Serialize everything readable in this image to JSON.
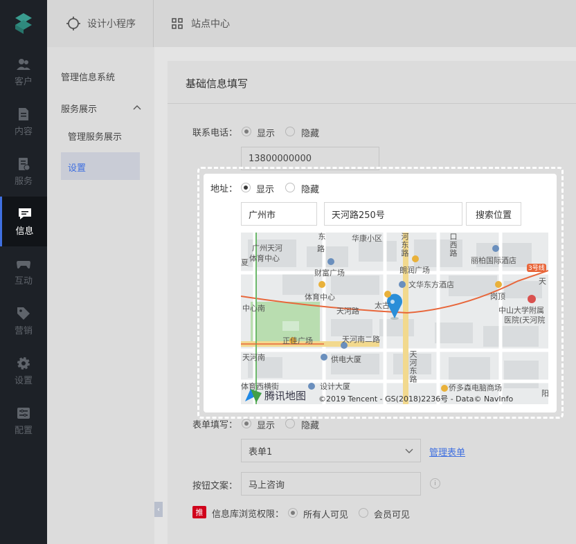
{
  "nav": {
    "items": [
      {
        "label": "客户",
        "icon": "customers-icon"
      },
      {
        "label": "内容",
        "icon": "content-icon"
      },
      {
        "label": "服务",
        "icon": "service-icon"
      },
      {
        "label": "信息",
        "icon": "message-icon"
      },
      {
        "label": "互动",
        "icon": "gamepad-icon"
      },
      {
        "label": "营销",
        "icon": "tag-icon"
      },
      {
        "label": "设置",
        "icon": "gear-icon"
      },
      {
        "label": "配置",
        "icon": "config-icon"
      }
    ],
    "active_index": 3,
    "accent": "#3f6fe0"
  },
  "topbar": {
    "tab1": "设计小程序",
    "tab2": "站点中心"
  },
  "subnav": {
    "system": "管理信息系统",
    "group": "服务展示",
    "item1": "管理服务展示",
    "item2": "设置"
  },
  "panel": {
    "title": "基础信息填写",
    "phone": {
      "label": "联系电话：",
      "show": "显示",
      "hide": "隐藏",
      "value": "13800000000"
    },
    "form": {
      "label": "表单填写：",
      "show": "显示",
      "hide": "隐藏",
      "selected": "表单1",
      "manage_link": "管理表单"
    },
    "button_text": {
      "label": "按钮文案：",
      "value": "马上咨询"
    },
    "permission": {
      "badge": "推",
      "label": "信息库浏览权限：",
      "opt1": "所有人可见",
      "opt2": "会员可见"
    }
  },
  "popup": {
    "label": "地址：",
    "show": "显示",
    "hide": "隐藏",
    "city": "广州市",
    "street": "天河路250号",
    "search_button": "搜索位置",
    "map": {
      "labels": {
        "a": "广州天河",
        "b": "体育中心",
        "c": "东",
        "d": "路",
        "e": "华康小区",
        "f": "河东路",
        "g": "口西路",
        "h": "丽柏国际酒店",
        "i": "朗润广场",
        "j": "文华东方酒店",
        "k": "财富广场",
        "l": "体育中心",
        "m": "中心南",
        "n": "天河路",
        "o": "太古",
        "p": "岗顶",
        "q": "中山大学附属",
        "r": "医院(天河院",
        "s": "正佳广场",
        "t": "天河南二路",
        "u": "天河南",
        "v": "供电大厦",
        "w": "天河东路",
        "x": "设计大厦",
        "y": "侨多森电脑商场",
        "z": "3号线",
        "aa": "天",
        "ab": "夏",
        "ac": "阳",
        "ad": "体育西横街"
      },
      "brand": "腾讯地图",
      "copyright": "©2019 Tencent - GS(2018)2236号 - Data© NavInfo"
    }
  }
}
